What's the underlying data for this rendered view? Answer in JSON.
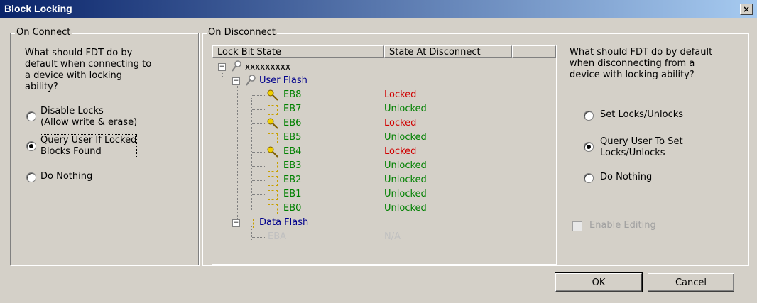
{
  "window": {
    "title": "Block Locking",
    "close_glyph": "×"
  },
  "on_connect": {
    "title": "On Connect",
    "question": [
      "What should FDT do by",
      "default when connecting to",
      "a device with locking",
      "ability?"
    ],
    "options": [
      {
        "lines": [
          "Disable Locks",
          "(Allow write & erase)"
        ],
        "checked": false
      },
      {
        "lines": [
          "Query User If Locked",
          "Blocks Found"
        ],
        "checked": true
      },
      {
        "lines": [
          "Do Nothing"
        ],
        "checked": false
      }
    ]
  },
  "on_disconnect": {
    "title": "On Disconnect",
    "columns": [
      "Lock Bit State",
      "State At Disconnect"
    ],
    "tree": {
      "root": "xxxxxxxxx",
      "user_flash": {
        "label": "User Flash",
        "blocks": [
          {
            "name": "EB8",
            "state": "Locked"
          },
          {
            "name": "EB7",
            "state": "Unlocked"
          },
          {
            "name": "EB6",
            "state": "Locked"
          },
          {
            "name": "EB5",
            "state": "Unlocked"
          },
          {
            "name": "EB4",
            "state": "Locked"
          },
          {
            "name": "EB3",
            "state": "Unlocked"
          },
          {
            "name": "EB2",
            "state": "Unlocked"
          },
          {
            "name": "EB1",
            "state": "Unlocked"
          },
          {
            "name": "EB0",
            "state": "Unlocked"
          }
        ]
      },
      "data_flash": {
        "label": "Data Flash",
        "blocks": [
          {
            "name": "EBA",
            "state": "N/A"
          }
        ]
      }
    },
    "question": [
      "What should FDT do by default",
      "when disconnecting from a",
      "device with locking ability?"
    ],
    "options": [
      {
        "lines": [
          "Set Locks/Unlocks"
        ],
        "checked": false
      },
      {
        "lines": [
          "Query User To Set",
          "Locks/Unlocks"
        ],
        "checked": true
      },
      {
        "lines": [
          "Do Nothing"
        ],
        "checked": false
      }
    ],
    "enable_editing": {
      "label": "Enable Editing",
      "checked": false,
      "disabled": true
    }
  },
  "buttons": {
    "ok": "OK",
    "cancel": "Cancel"
  },
  "colors": {
    "locked": "#d00000",
    "unlocked": "#008000",
    "node": "#00008b",
    "title_bar": "#0a246a"
  }
}
